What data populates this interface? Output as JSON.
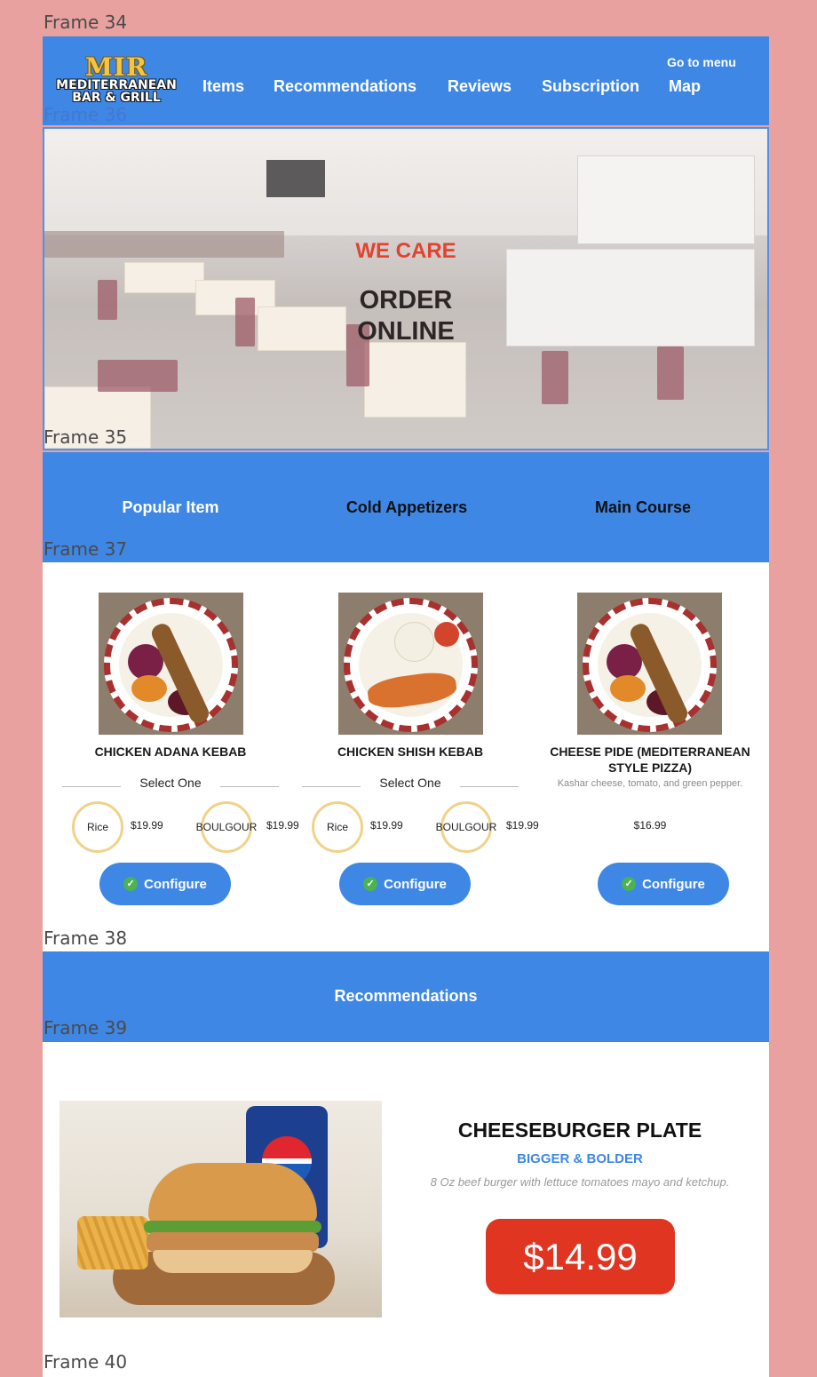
{
  "frames": {
    "f34": "Frame 34",
    "f36": "Frame 36",
    "f35": "Frame 35",
    "f37": "Frame 37",
    "f38": "Frame 38",
    "f39": "Frame 39",
    "f40": "Frame 40"
  },
  "header": {
    "logo_main": "MIR",
    "logo_line1": "MEDITERRANEAN",
    "logo_line2": "BAR & GRILL",
    "nav": [
      "Items",
      "Recommendations",
      "Reviews",
      "Subscription",
      "Map"
    ],
    "goto_menu": "Go to menu"
  },
  "hero": {
    "kicker": "WE CARE",
    "title_line1": "ORDER",
    "title_line2": "ONLINE"
  },
  "categories": [
    {
      "label": "Popular Item",
      "color": "#ffffff"
    },
    {
      "label": "Cold Appetizers",
      "color": "#111111"
    },
    {
      "label": "Main Course",
      "color": "#111111"
    }
  ],
  "items": [
    {
      "name": "CHICKEN ADANA KEBAB",
      "select_label": "Select One",
      "options": [
        {
          "label": "Rice",
          "price": "$19.99"
        },
        {
          "label": "BOULGOUR",
          "price": "$19.99"
        }
      ],
      "button": "Configure"
    },
    {
      "name": "CHICKEN SHISH KEBAB",
      "select_label": "Select One",
      "options": [
        {
          "label": "Rice",
          "price": "$19.99"
        },
        {
          "label": "BOULGOUR",
          "price": "$19.99"
        }
      ],
      "button": "Configure"
    },
    {
      "name": "CHEESE PIDE (MEDITERRANEAN STYLE PIZZA)",
      "description": "Kashar cheese, tomato, and green pepper.",
      "price": "$16.99",
      "button": "Configure"
    }
  ],
  "recommendations": {
    "title": "Recommendations",
    "featured": {
      "name": "CHEESEBURGER PLATE",
      "tagline": "BIGGER & BOLDER",
      "description": "8 Oz beef burger with lettuce tomatoes mayo and ketchup.",
      "price": "$14.99"
    }
  },
  "colors": {
    "background": "#e8a19f",
    "primary_blue": "#3f87e5",
    "accent_red": "#e03521",
    "option_ring": "#f0d28a",
    "check_green": "#4bb34f"
  }
}
